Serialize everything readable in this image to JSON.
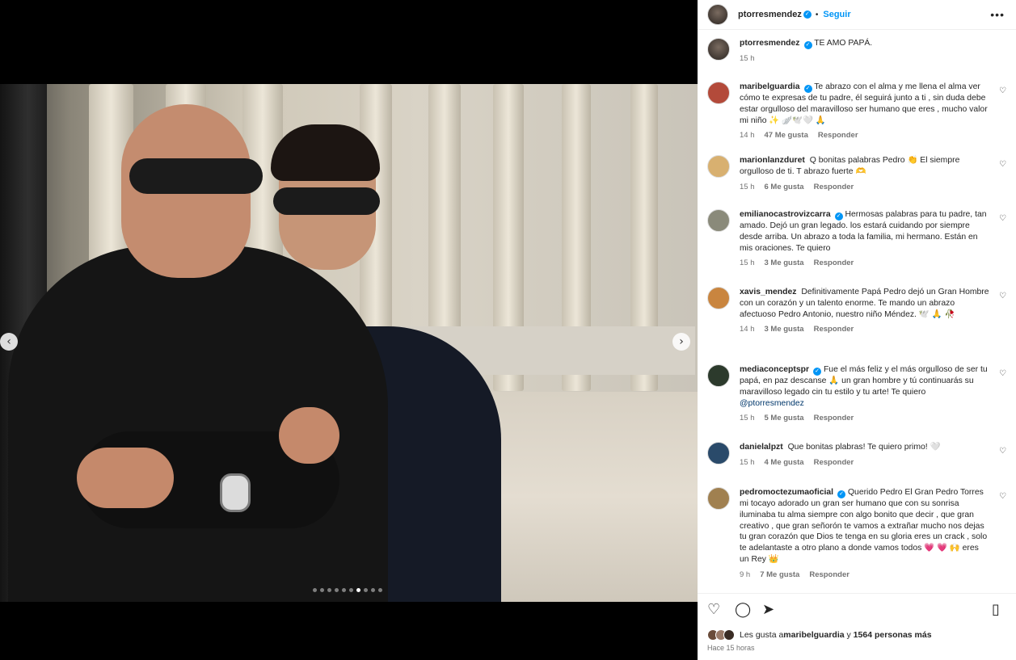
{
  "post": {
    "username": "ptorresmendez",
    "follow_label": "Seguir",
    "more_label": "•••",
    "caption_text": "TE AMO PAPÁ.",
    "caption_time": "15 h",
    "carousel_dot_count": 10,
    "carousel_active_index": 6
  },
  "comments": [
    {
      "username": "maribelguardia",
      "verified": true,
      "text": "Te abrazo con el alma y me llena el alma ver cómo te expresas de tu padre, él seguirá junto a ti , sin duda debe estar orgulloso del maravilloso ser humano que eres , mucho valor mi niño ✨ 🪽🕊️🤍 🙏",
      "time": "14 h",
      "likes": "47 Me gusta",
      "reply": "Responder"
    },
    {
      "username": "marionlanzduret",
      "verified": false,
      "text": "Q bonitas palabras Pedro 👏 El siempre orgulloso de ti. T abrazo fuerte 🫶",
      "time": "15 h",
      "likes": "6 Me gusta",
      "reply": "Responder"
    },
    {
      "username": "emilianocastrovizcarra",
      "verified": true,
      "text": "Hermosas palabras para tu padre, tan amado. Dejó un gran legado. los estará cuidando por siempre desde arriba. Un abrazo a toda la familia, mi hermano. Están en mis oraciones. Te quiero",
      "time": "15 h",
      "likes": "3 Me gusta",
      "reply": "Responder"
    },
    {
      "username": "xavis_mendez",
      "verified": false,
      "text": "Definitivamente Papá Pedro dejó un Gran Hombre con un corazón y un talento enorme. Te mando un abrazo afectuoso Pedro Antonio, nuestro niño Méndez. 🕊️ 🙏 🥀",
      "time": "14 h",
      "likes": "3 Me gusta",
      "reply": "Responder"
    },
    {
      "username": "mediaconceptspr",
      "verified": true,
      "text": "Fue el más feliz y el más orgulloso de ser tu papá, en paz descanse 🙏 un gran hombre y tú continuarás su maravilloso legado cin tu estilo y tu arte! Te quiero",
      "mention": "@ptorresmendez",
      "time": "15 h",
      "likes": "5 Me gusta",
      "reply": "Responder"
    },
    {
      "username": "danielalpzt",
      "verified": false,
      "text": "Que bonitas plabras! Te quiero primo! 🤍",
      "time": "15 h",
      "likes": "4 Me gusta",
      "reply": "Responder"
    },
    {
      "username": "pedromoctezumaoficial",
      "verified": true,
      "text": "Querido Pedro El Gran Pedro Torres mi tocayo adorado un gran ser humano que con su sonrisa iluminaba tu alma siempre con algo bonito que decir , que gran creativo , que gran señorón te vamos a extrañar mucho nos dejas tu gran corazón que Dios te tenga en su gloria eres un crack , solo te adelantaste a otro plano a donde vamos todos 💗 💗 🙌 eres un Rey 👑",
      "time": "9 h",
      "likes": "7 Me gusta",
      "reply": "Responder"
    }
  ],
  "footer": {
    "likes_prefix": "Les gusta a ",
    "likes_user": "maribelguardia",
    "likes_suffix": " y ",
    "likes_count": "1564 personas más",
    "timestamp": "Hace 15 horas"
  },
  "icons": {
    "heart": "heart-icon",
    "comment": "comment-icon",
    "share": "share-icon",
    "bookmark": "bookmark-icon",
    "prev": "chevron-left-icon",
    "next": "chevron-right-icon"
  }
}
